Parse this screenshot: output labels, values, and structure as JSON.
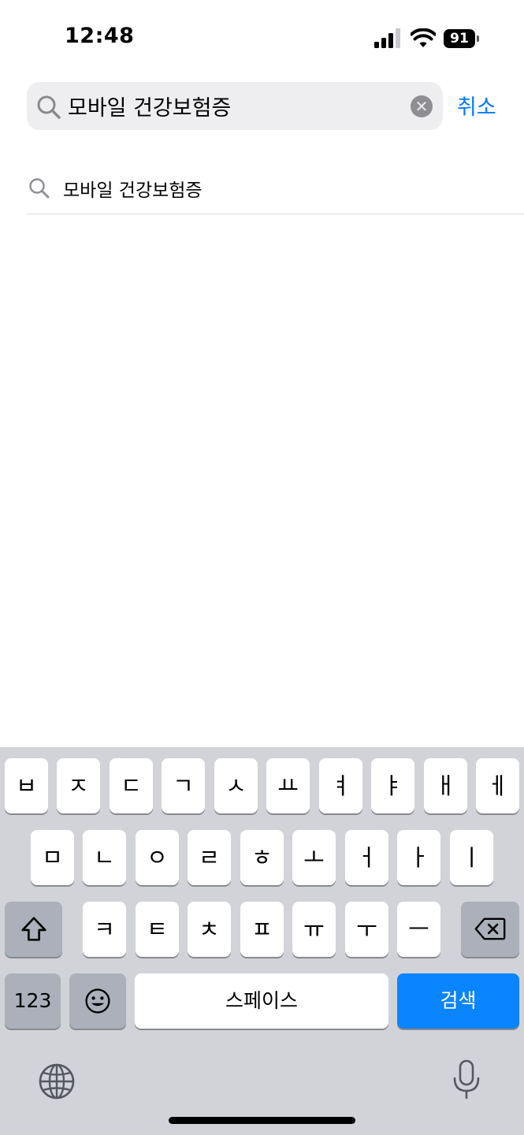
{
  "status_bar": {
    "time": "12:48",
    "battery": "91"
  },
  "search": {
    "query": "모바일 건강보험증",
    "cancel_label": "취소"
  },
  "suggestions": [
    {
      "label": "모바일 건강보험증"
    }
  ],
  "keyboard": {
    "row1": [
      "ㅂ",
      "ㅈ",
      "ㄷ",
      "ㄱ",
      "ㅅ",
      "ㅛ",
      "ㅕ",
      "ㅑ",
      "ㅐ",
      "ㅔ"
    ],
    "row2": [
      "ㅁ",
      "ㄴ",
      "ㅇ",
      "ㄹ",
      "ㅎ",
      "ㅗ",
      "ㅓ",
      "ㅏ",
      "ㅣ"
    ],
    "row3": [
      "ㅋ",
      "ㅌ",
      "ㅊ",
      "ㅍ",
      "ㅠ",
      "ㅜ",
      "ㅡ"
    ],
    "numbers_label": "123",
    "space_label": "스페이스",
    "search_label": "검색",
    "accent_color": "#0a84ff"
  },
  "icons": {
    "shift": "shift-icon",
    "delete": "backspace-icon",
    "emoji": "emoji-icon",
    "globe": "globe-icon",
    "mic": "microphone-icon"
  }
}
